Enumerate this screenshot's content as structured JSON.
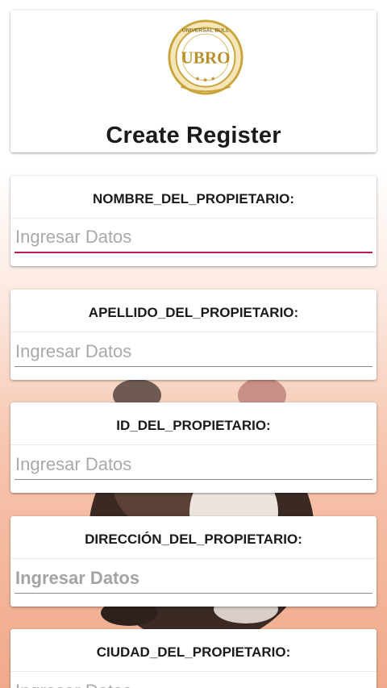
{
  "header": {
    "title": "Create Register",
    "logo_icon": "ubro-seal-logo",
    "logo_text": "UNIVERSAL BULL REGISTRY ONLINE UBRO"
  },
  "form": {
    "fields": [
      {
        "label": "NOMBRE_DEL_PROPIETARIO:",
        "placeholder": "Ingresar Datos",
        "value": "",
        "focused": true
      },
      {
        "label": "APELLIDO_DEL_PROPIETARIO:",
        "placeholder": "Ingresar Datos",
        "value": ""
      },
      {
        "label": "ID_DEL_PROPIETARIO:",
        "placeholder": "Ingresar Datos",
        "value": ""
      },
      {
        "label": "DIRECCIÓN_DEL_PROPIETARIO:",
        "placeholder": "Ingresar Datos",
        "value": ""
      },
      {
        "label": "CIUDAD_DEL_PROPIETARIO:",
        "placeholder": "Ingresar Datos",
        "value": ""
      }
    ]
  },
  "colors": {
    "accent": "#c2185b",
    "gold": "#c9a43a",
    "background_peach": "#f1a98b"
  }
}
